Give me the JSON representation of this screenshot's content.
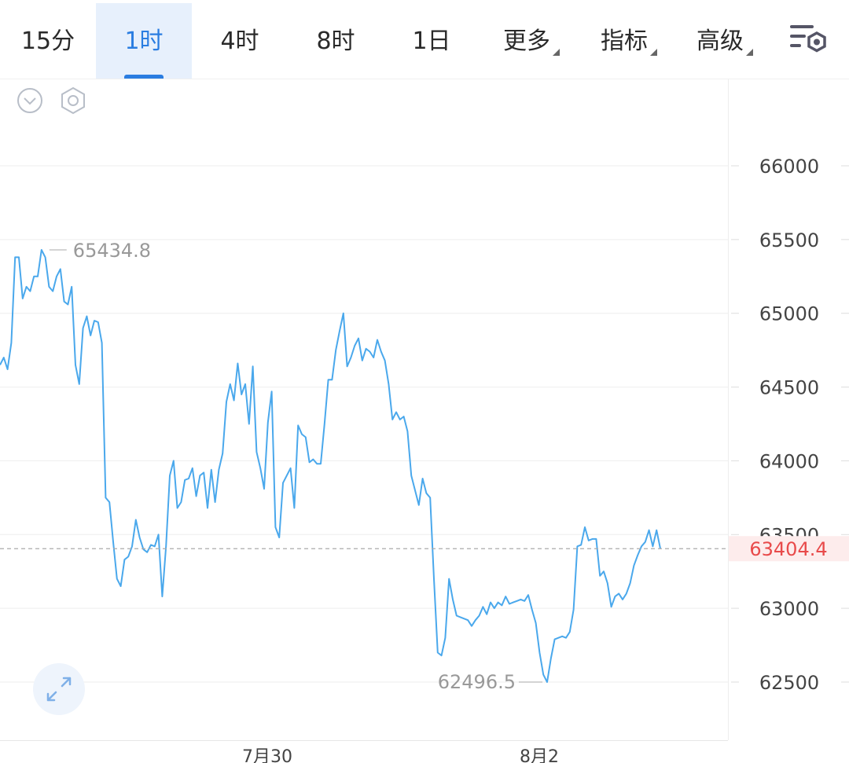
{
  "tabs": [
    {
      "label": "15分",
      "active": false
    },
    {
      "label": "1时",
      "active": true
    },
    {
      "label": "4时",
      "active": false
    },
    {
      "label": "8时",
      "active": false
    },
    {
      "label": "1日",
      "active": false
    }
  ],
  "dropdowns": [
    {
      "label": "更多"
    },
    {
      "label": "指标"
    },
    {
      "label": "高级"
    }
  ],
  "icons": {
    "settings": "chart-settings-icon",
    "collapse": "chevron-down-circle-icon",
    "hex": "hexagon-settings-icon",
    "expand": "fullscreen-expand-icon"
  },
  "colors": {
    "accent": "#2a7de1",
    "line": "#4aa8ec",
    "price_tag": "#e84a4a",
    "grid": "#eeeeee"
  },
  "chart_data": {
    "type": "line",
    "ylim": [
      62250,
      66250
    ],
    "y_ticks": [
      62500,
      63000,
      63500,
      64000,
      64500,
      65000,
      65500,
      66000
    ],
    "y_tick_labels": [
      "62500",
      "63000",
      "63500",
      "64000",
      "64500",
      "65000",
      "65500",
      "66000"
    ],
    "x_labels": [
      "7月30",
      "8月2"
    ],
    "current_price": 63404.4,
    "current_price_label": "63404.4",
    "high_label": "65434.8",
    "low_label": "62496.5",
    "series": [
      {
        "values": [
          64650,
          64700,
          64620,
          64800,
          65380,
          65380,
          65100,
          65180,
          65150,
          65250,
          65250,
          65430,
          65380,
          65180,
          65150,
          65250,
          65300,
          65080,
          65060,
          65180,
          64650,
          64520,
          64900,
          64980,
          64850,
          64950,
          64940,
          64800,
          63750,
          63720,
          63450,
          63200,
          63150,
          63330,
          63350,
          63420,
          63600,
          63480,
          63400,
          63380,
          63430,
          63420,
          63500,
          63080,
          63420,
          63900,
          64000,
          63680,
          63720,
          63870,
          63880,
          63950,
          63760,
          63900,
          63920,
          63680,
          63940,
          63720,
          63940,
          64050,
          64400,
          64520,
          64410,
          64660,
          64450,
          64520,
          64250,
          64640,
          64060,
          63950,
          63810,
          64260,
          64470,
          63550,
          63480,
          63850,
          63900,
          63950,
          63680,
          64240,
          64180,
          64160,
          63990,
          64010,
          63980,
          63980,
          64250,
          64550,
          64550,
          64750,
          64880,
          65000,
          64640,
          64700,
          64780,
          64830,
          64680,
          64760,
          64740,
          64700,
          64820,
          64740,
          64680,
          64520,
          64280,
          64330,
          64280,
          64300,
          64200,
          63900,
          63800,
          63700,
          63880,
          63780,
          63750,
          63200,
          62700,
          62680,
          62800,
          63200,
          63060,
          62950,
          62940,
          62930,
          62920,
          62880,
          62920,
          62950,
          63010,
          62960,
          63040,
          63000,
          63040,
          63020,
          63080,
          63030,
          63040,
          63050,
          63060,
          63050,
          63090,
          62990,
          62900,
          62700,
          62550,
          62500,
          62660,
          62790,
          62800,
          62810,
          62800,
          62840,
          62990,
          63420,
          63430,
          63550,
          63460,
          63470,
          63470,
          63220,
          63250,
          63170,
          63010,
          63080,
          63100,
          63060,
          63100,
          63170,
          63290,
          63360,
          63420,
          63450,
          63530,
          63420,
          63530,
          63404.4
        ]
      }
    ]
  }
}
